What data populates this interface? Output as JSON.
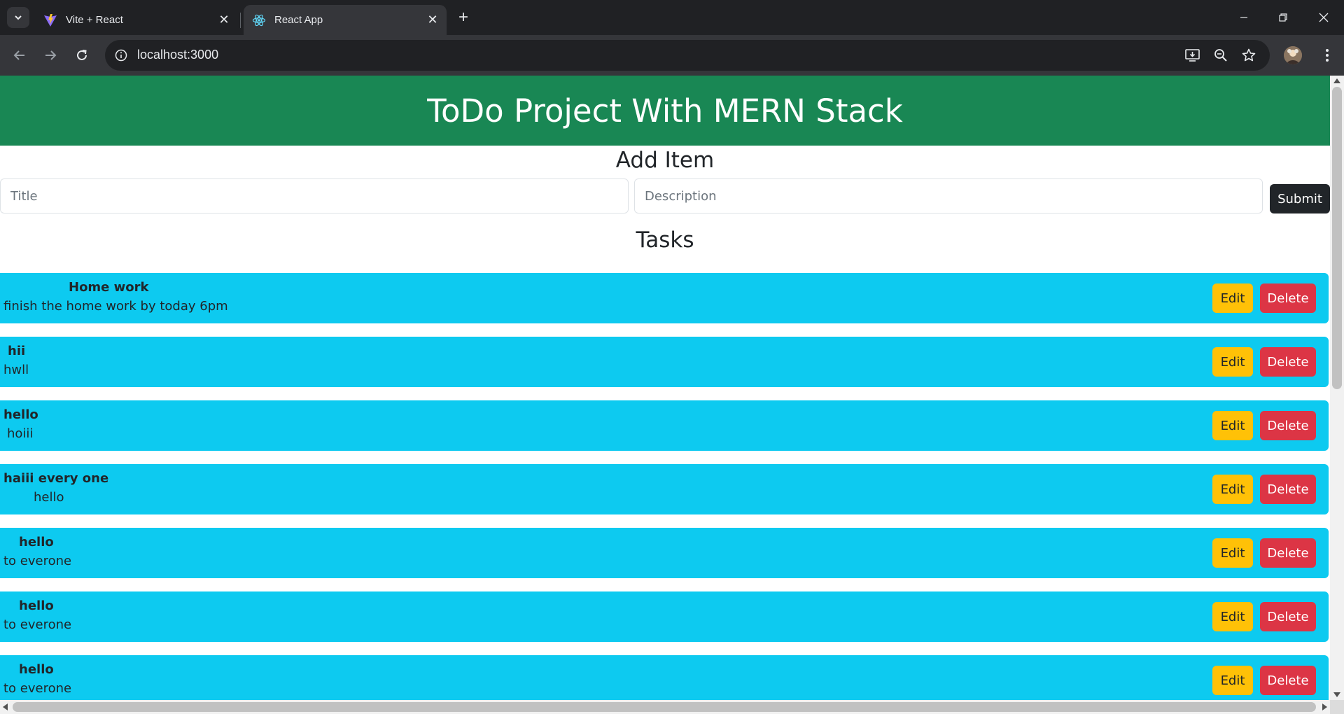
{
  "browser": {
    "tabs": [
      {
        "title": "Vite + React",
        "icon": "vite-icon",
        "active": false
      },
      {
        "title": "React App",
        "icon": "react-icon",
        "active": true
      }
    ],
    "url": "localhost:3000"
  },
  "page": {
    "header": "ToDo Project With MERN Stack",
    "add_section_title": "Add Item",
    "title_placeholder": "Title",
    "description_placeholder": "Description",
    "submit_label": "Submit",
    "tasks_section_title": "Tasks",
    "edit_label": "Edit",
    "delete_label": "Delete",
    "tasks": [
      {
        "title": "Home work",
        "description": "finish the home work by today 6pm"
      },
      {
        "title": "hii",
        "description": "hwll"
      },
      {
        "title": "hello",
        "description": "hoiii"
      },
      {
        "title": "haiii every one",
        "description": "hello"
      },
      {
        "title": "hello",
        "description": "to everone"
      },
      {
        "title": "hello",
        "description": "to everone"
      },
      {
        "title": "hello",
        "description": "to everone"
      }
    ]
  },
  "colors": {
    "header_bg": "#198754",
    "task_bg": "#0dcaf0",
    "edit_bg": "#ffc107",
    "delete_bg": "#dc3545",
    "submit_bg": "#212529"
  }
}
